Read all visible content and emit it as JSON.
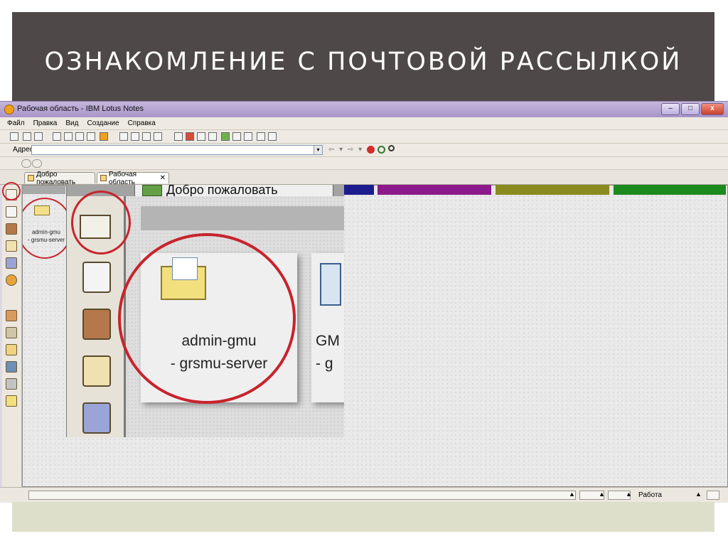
{
  "slide": {
    "title": "ОЗНАКОМЛЕНИЕ С ПОЧТОВОЙ РАССЫЛКОЙ"
  },
  "window": {
    "title": "Рабочая область - IBM Lotus Notes",
    "app_icon": "lotus-notes-icon",
    "controls": {
      "minimize": "–",
      "maximize": "□",
      "close": "x"
    }
  },
  "menu": {
    "items": [
      "Файл",
      "Правка",
      "Вид",
      "Создание",
      "Справка"
    ]
  },
  "address": {
    "label": "Адрес",
    "value": "",
    "nav_arrows": "⇦ ▾ ⇨ ▾"
  },
  "tabs": [
    {
      "label": "Добро пожаловать",
      "icon": "home-icon",
      "active": false
    },
    {
      "label": "Рабочая область",
      "icon": "workspace-icon",
      "active": true,
      "close": "✕"
    }
  ],
  "sidebar": {
    "icons": [
      "mail-icon",
      "calendar-icon",
      "contacts-icon",
      "todo-icon",
      "replicator-icon",
      "lotus-icon",
      "db-icon",
      "db-icon",
      "folder-icon",
      "db-icon",
      "db-icon",
      "mail-icon"
    ]
  },
  "workspace": {
    "small_db_label": "admin-gmu\n- grsmu-server",
    "zoom": {
      "tab_label": "Добро пожаловать",
      "card_label": "admin-gmu\n- grsmu-server",
      "card2_label": "GM\n- g"
    },
    "color_tabs": [
      "#1c1c8f",
      "#8c1a8c",
      "#8b8a1f",
      "#1c8a1c"
    ]
  },
  "status": {
    "location": "Работа"
  },
  "colors": {
    "header_bg": "#4f4848",
    "footer_bg": "#dedfca",
    "highlight": "#c8232c"
  }
}
